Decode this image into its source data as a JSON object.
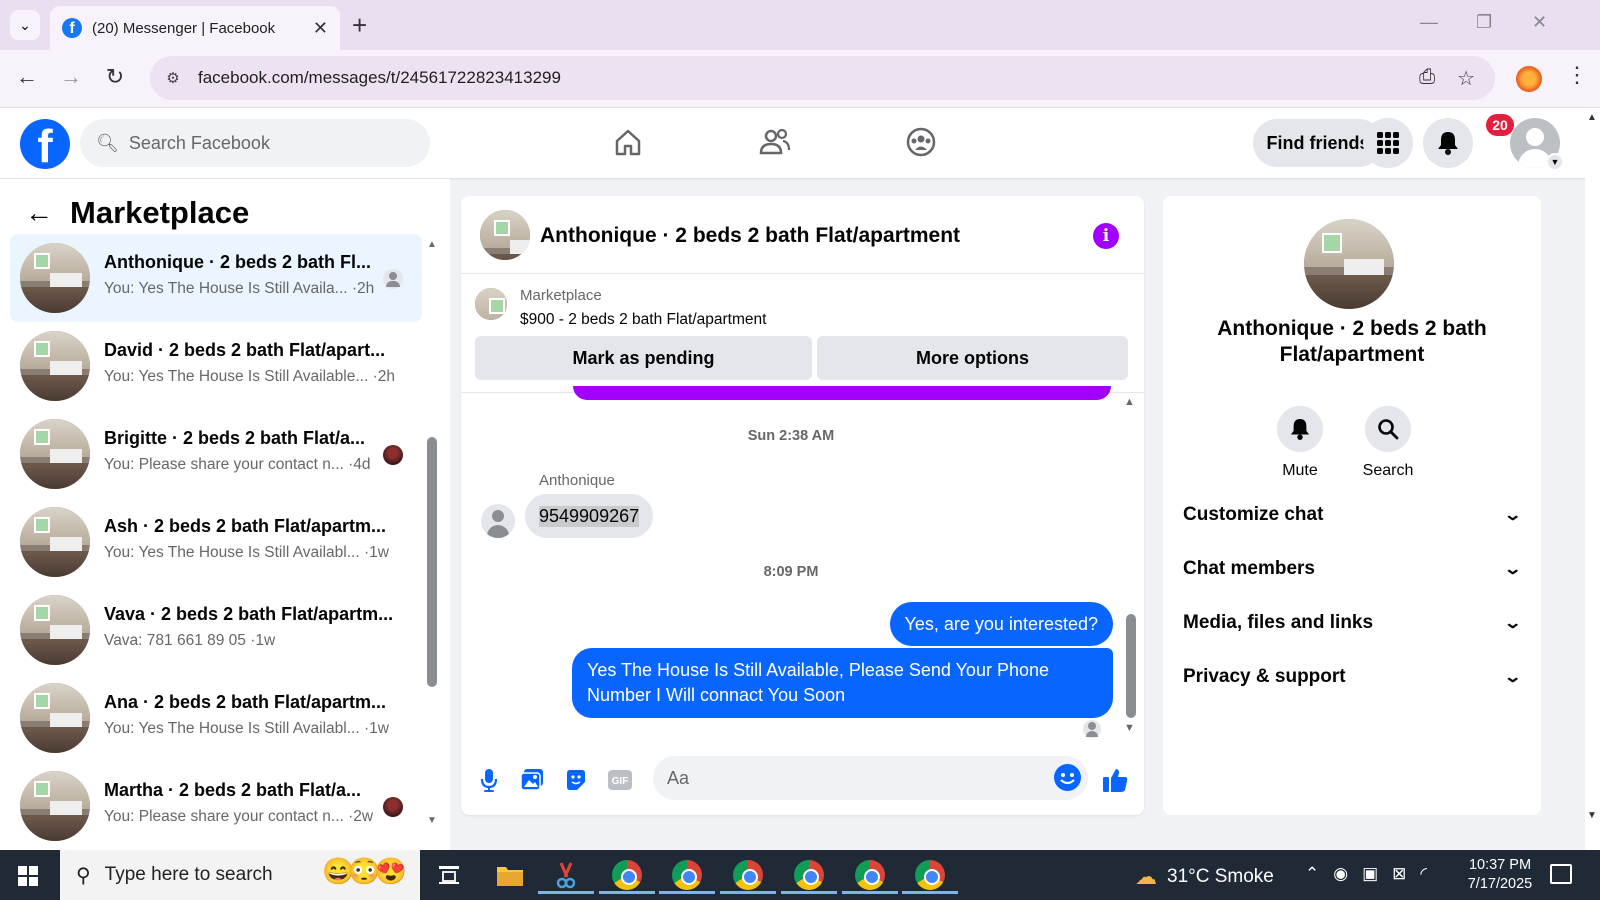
{
  "browser": {
    "tab_title": "(20) Messenger | Facebook",
    "url": "facebook.com/messages/t/24561722823413299"
  },
  "fb": {
    "search_placeholder": "Search Facebook",
    "find_friends": "Find friends",
    "notifications_count": "20",
    "brand_color": "#0866ff"
  },
  "sidebar": {
    "title": "Marketplace",
    "conversations": [
      {
        "name": "Anthonique · 2 beds 2 bath Fl...",
        "preview": "You: Yes The House Is Still Availa... ·2h",
        "active": true
      },
      {
        "name": "David · 2 beds 2 bath Flat/apart...",
        "preview": "You: Yes The House Is Still Available... ·2h"
      },
      {
        "name": "Brigitte · 2 beds 2 bath Flat/a...",
        "preview": "You: Please share your contact n... ·4d"
      },
      {
        "name": "Ash · 2 beds 2 bath Flat/apartm...",
        "preview": "You: Yes The House Is Still Availabl... ·1w"
      },
      {
        "name": "Vava · 2 beds 2 bath Flat/apartm...",
        "preview": "Vava: 781 661 89 05 ·1w"
      },
      {
        "name": "Ana · 2 beds 2 bath Flat/apartm...",
        "preview": "You: Yes The House Is Still Availabl... ·1w"
      },
      {
        "name": "Martha · 2 beds 2 bath Flat/a...",
        "preview": "You: Please share your contact n... ·2w"
      }
    ]
  },
  "chat": {
    "title": "Anthonique · 2 beds 2 bath Flat/apartment",
    "listing_label": "Marketplace",
    "listing_desc": "$900 - 2 beds 2 bath Flat/apartment",
    "mark_pending": "Mark as pending",
    "more_options": "More options",
    "timestamp1": "Sun 2:38 AM",
    "sender_name": "Anthonique",
    "incoming_msg": "9549909267",
    "timestamp2": "8:09 PM",
    "outgoing_msg1": "Yes, are you interested?",
    "outgoing_msg2": "Yes The House Is Still Available, Please Send Your Phone Number I Will connact You Soon",
    "input_placeholder": "Aa"
  },
  "details": {
    "title": "Anthonique · 2 beds 2 bath Flat/apartment",
    "mute": "Mute",
    "search": "Search",
    "sections": [
      "Customize chat",
      "Chat members",
      "Media, files and links",
      "Privacy & support"
    ]
  },
  "taskbar": {
    "search_placeholder": "Type here to search",
    "weather": "31°C  Smoke",
    "time": "10:37 PM",
    "date": "7/17/2025"
  }
}
